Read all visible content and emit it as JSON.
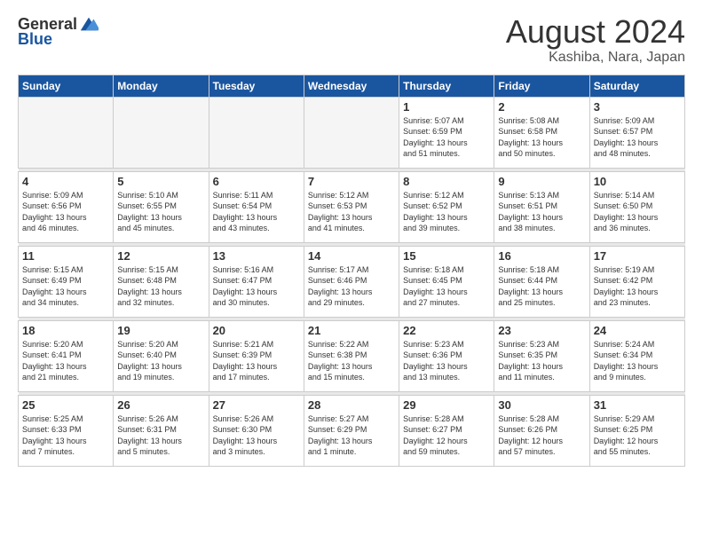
{
  "logo": {
    "general": "General",
    "blue": "Blue"
  },
  "header": {
    "title": "August 2024",
    "subtitle": "Kashiba, Nara, Japan"
  },
  "weekdays": [
    "Sunday",
    "Monday",
    "Tuesday",
    "Wednesday",
    "Thursday",
    "Friday",
    "Saturday"
  ],
  "weeks": [
    [
      {
        "day": "",
        "info": ""
      },
      {
        "day": "",
        "info": ""
      },
      {
        "day": "",
        "info": ""
      },
      {
        "day": "",
        "info": ""
      },
      {
        "day": "1",
        "info": "Sunrise: 5:07 AM\nSunset: 6:59 PM\nDaylight: 13 hours\nand 51 minutes."
      },
      {
        "day": "2",
        "info": "Sunrise: 5:08 AM\nSunset: 6:58 PM\nDaylight: 13 hours\nand 50 minutes."
      },
      {
        "day": "3",
        "info": "Sunrise: 5:09 AM\nSunset: 6:57 PM\nDaylight: 13 hours\nand 48 minutes."
      }
    ],
    [
      {
        "day": "4",
        "info": "Sunrise: 5:09 AM\nSunset: 6:56 PM\nDaylight: 13 hours\nand 46 minutes."
      },
      {
        "day": "5",
        "info": "Sunrise: 5:10 AM\nSunset: 6:55 PM\nDaylight: 13 hours\nand 45 minutes."
      },
      {
        "day": "6",
        "info": "Sunrise: 5:11 AM\nSunset: 6:54 PM\nDaylight: 13 hours\nand 43 minutes."
      },
      {
        "day": "7",
        "info": "Sunrise: 5:12 AM\nSunset: 6:53 PM\nDaylight: 13 hours\nand 41 minutes."
      },
      {
        "day": "8",
        "info": "Sunrise: 5:12 AM\nSunset: 6:52 PM\nDaylight: 13 hours\nand 39 minutes."
      },
      {
        "day": "9",
        "info": "Sunrise: 5:13 AM\nSunset: 6:51 PM\nDaylight: 13 hours\nand 38 minutes."
      },
      {
        "day": "10",
        "info": "Sunrise: 5:14 AM\nSunset: 6:50 PM\nDaylight: 13 hours\nand 36 minutes."
      }
    ],
    [
      {
        "day": "11",
        "info": "Sunrise: 5:15 AM\nSunset: 6:49 PM\nDaylight: 13 hours\nand 34 minutes."
      },
      {
        "day": "12",
        "info": "Sunrise: 5:15 AM\nSunset: 6:48 PM\nDaylight: 13 hours\nand 32 minutes."
      },
      {
        "day": "13",
        "info": "Sunrise: 5:16 AM\nSunset: 6:47 PM\nDaylight: 13 hours\nand 30 minutes."
      },
      {
        "day": "14",
        "info": "Sunrise: 5:17 AM\nSunset: 6:46 PM\nDaylight: 13 hours\nand 29 minutes."
      },
      {
        "day": "15",
        "info": "Sunrise: 5:18 AM\nSunset: 6:45 PM\nDaylight: 13 hours\nand 27 minutes."
      },
      {
        "day": "16",
        "info": "Sunrise: 5:18 AM\nSunset: 6:44 PM\nDaylight: 13 hours\nand 25 minutes."
      },
      {
        "day": "17",
        "info": "Sunrise: 5:19 AM\nSunset: 6:42 PM\nDaylight: 13 hours\nand 23 minutes."
      }
    ],
    [
      {
        "day": "18",
        "info": "Sunrise: 5:20 AM\nSunset: 6:41 PM\nDaylight: 13 hours\nand 21 minutes."
      },
      {
        "day": "19",
        "info": "Sunrise: 5:20 AM\nSunset: 6:40 PM\nDaylight: 13 hours\nand 19 minutes."
      },
      {
        "day": "20",
        "info": "Sunrise: 5:21 AM\nSunset: 6:39 PM\nDaylight: 13 hours\nand 17 minutes."
      },
      {
        "day": "21",
        "info": "Sunrise: 5:22 AM\nSunset: 6:38 PM\nDaylight: 13 hours\nand 15 minutes."
      },
      {
        "day": "22",
        "info": "Sunrise: 5:23 AM\nSunset: 6:36 PM\nDaylight: 13 hours\nand 13 minutes."
      },
      {
        "day": "23",
        "info": "Sunrise: 5:23 AM\nSunset: 6:35 PM\nDaylight: 13 hours\nand 11 minutes."
      },
      {
        "day": "24",
        "info": "Sunrise: 5:24 AM\nSunset: 6:34 PM\nDaylight: 13 hours\nand 9 minutes."
      }
    ],
    [
      {
        "day": "25",
        "info": "Sunrise: 5:25 AM\nSunset: 6:33 PM\nDaylight: 13 hours\nand 7 minutes."
      },
      {
        "day": "26",
        "info": "Sunrise: 5:26 AM\nSunset: 6:31 PM\nDaylight: 13 hours\nand 5 minutes."
      },
      {
        "day": "27",
        "info": "Sunrise: 5:26 AM\nSunset: 6:30 PM\nDaylight: 13 hours\nand 3 minutes."
      },
      {
        "day": "28",
        "info": "Sunrise: 5:27 AM\nSunset: 6:29 PM\nDaylight: 13 hours\nand 1 minute."
      },
      {
        "day": "29",
        "info": "Sunrise: 5:28 AM\nSunset: 6:27 PM\nDaylight: 12 hours\nand 59 minutes."
      },
      {
        "day": "30",
        "info": "Sunrise: 5:28 AM\nSunset: 6:26 PM\nDaylight: 12 hours\nand 57 minutes."
      },
      {
        "day": "31",
        "info": "Sunrise: 5:29 AM\nSunset: 6:25 PM\nDaylight: 12 hours\nand 55 minutes."
      }
    ]
  ]
}
